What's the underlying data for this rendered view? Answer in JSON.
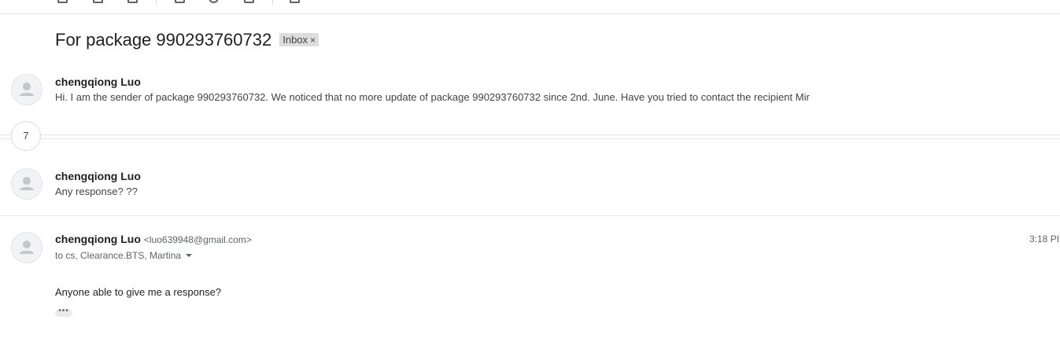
{
  "thread": {
    "subject": "For package 990293760732",
    "label": "Inbox",
    "label_remove": "×",
    "collapsed_count": "7"
  },
  "messages": [
    {
      "sender": "chengqiong Luo",
      "snippet": "Hi. I am the sender of package 990293760732. We noticed that no more update of package 990293760732 since 2nd. June. Have you tried to contact the recipient Mir"
    },
    {
      "sender": "chengqiong Luo",
      "snippet": "Any response? ??"
    },
    {
      "sender": "chengqiong Luo",
      "email": "<luo639948@gmail.com>",
      "time": "3:18 PI",
      "recipients": "to cs, Clearance.BTS, Martina",
      "body": "Anyone able to give me a response?",
      "more": "•••"
    }
  ],
  "icons": {
    "avatar": "person-icon",
    "recipients_toggle": "chevron-down-icon"
  }
}
